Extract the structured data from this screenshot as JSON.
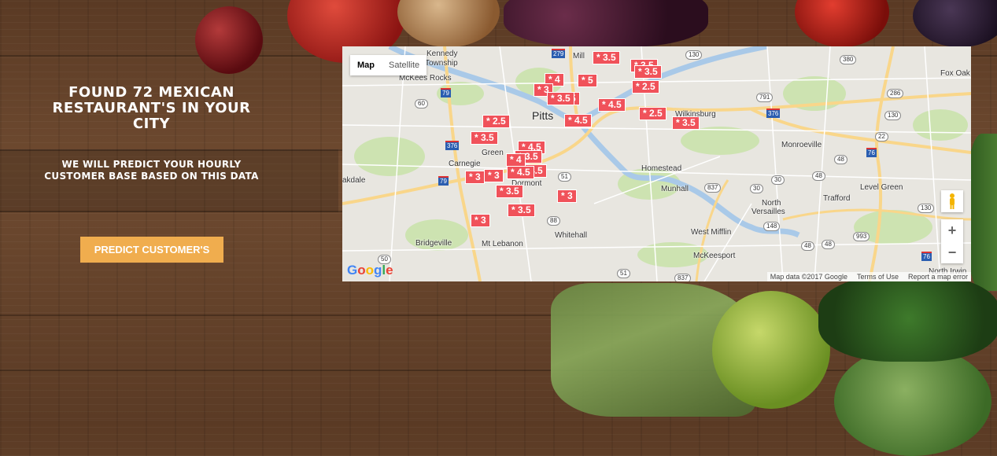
{
  "hero": {
    "headline": "FOUND 72 MEXICAN RESTAURANT'S IN YOUR CITY",
    "subline": "WE WILL PREDICT YOUR HOURLY CUSTOMER BASE BASED ON THIS DATA",
    "predict_button": "PREDICT CUSTOMER'S"
  },
  "map": {
    "type_controls": [
      "Map",
      "Satellite"
    ],
    "active_type": "Map",
    "zoom_in": "+",
    "zoom_out": "−",
    "logo": "Google",
    "attribution": [
      "Map data ©2017 Google",
      "Terms of Use",
      "Report a map error"
    ],
    "places": {
      "kennedy": "Kennedy",
      "kennedy2": "Township",
      "mckees_rocks": "McKees Rocks",
      "mill": "Mill",
      "pitts": "Pitts",
      "green": "Green",
      "carnegie": "Carnegie",
      "dormont": "Dormont",
      "oakdale": "akdale",
      "bridgeville": "Bridgeville",
      "mt_lebanon": "Mt Lebanon",
      "whitehall": "Whitehall",
      "homestead": "Homestead",
      "munhall": "Munhall",
      "west_mifflin": "West Mifflin",
      "mckeesport": "McKeesport",
      "wilkinsburg": "Wilkinsburg",
      "monroeville": "Monroeville",
      "north": "North",
      "versailles": "Versailles",
      "trafford": "Trafford",
      "level_green": "Level Green",
      "fox_oak": "Fox Oak",
      "north_irwin": "North Irwin",
      "ho": "Ho"
    },
    "markers": [
      "* 3.5",
      "* 3.5",
      "* 3.5",
      "* 4",
      "* 5",
      "* 2.5",
      "* 3",
      "* 4.5",
      "* 4.5",
      "* 4.5",
      "* 2.5",
      "* 2.5",
      "* 4.5",
      "* 3.5",
      "* 3.5",
      "* 4.5",
      "* 3.5",
      "* 4",
      "* 3",
      "* 3",
      "* 4.5",
      "* 3.5",
      "* 3",
      "* 3.5",
      "* 3",
      "* 3.5"
    ],
    "shields": [
      "130",
      "380",
      "791",
      "286",
      "130",
      "22",
      "48",
      "30",
      "837",
      "837",
      "48",
      "30",
      "130",
      "993",
      "48",
      "148",
      "48",
      "51",
      "88",
      "51",
      "50",
      "837",
      "88",
      "60",
      "50",
      "50"
    ],
    "interstates": [
      "279",
      "79",
      "376",
      "376",
      "76",
      "79",
      "76"
    ]
  }
}
